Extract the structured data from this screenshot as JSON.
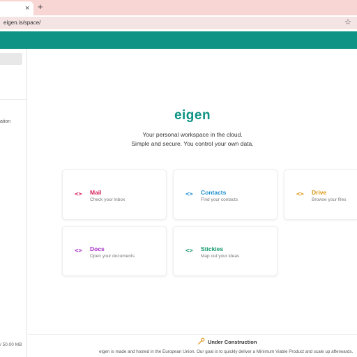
{
  "browser": {
    "tab_close": "×",
    "new_tab": "+",
    "url": "eigen.is/space/",
    "star": "☆"
  },
  "sidebar": {
    "partial_item": "ation",
    "storage": "/ 50.00 MB"
  },
  "main": {
    "logo": "eigen",
    "tagline_1": "Your personal workspace in the cloud.",
    "tagline_2": "Simple and secure. You control your own data.",
    "icon_glyph": "<>",
    "cards": [
      {
        "title": "Mail",
        "subtitle": "Check your inbox",
        "color": "#d6245a"
      },
      {
        "title": "Contacts",
        "subtitle": "Find your contacts",
        "color": "#1d8fce"
      },
      {
        "title": "Drive",
        "subtitle": "Browse your files",
        "color": "#d99512"
      },
      {
        "title": "Docs",
        "subtitle": "Open your documents",
        "color": "#a428c4"
      },
      {
        "title": "Stickies",
        "subtitle": "Map out your ideas",
        "color": "#12986a"
      }
    ]
  },
  "footer": {
    "title": "Under Construction",
    "text": "eigen is made and hosted in the European Union. Our goal is to quickly deliver a Minimum Viable Product and scale up afterwards."
  },
  "colors": {
    "brand": "#0e9384",
    "tab_strip": "#f8d6d3",
    "construction_icon": "#e09a2a"
  }
}
